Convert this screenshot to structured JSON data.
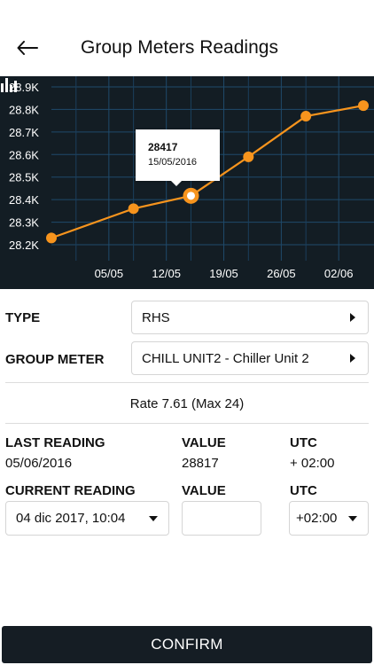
{
  "header": {
    "title": "Group Meters Readings",
    "back_icon": "arrow-left-icon"
  },
  "chart_data": {
    "type": "line",
    "x": [
      "28/04/2016",
      "08/05/2016",
      "15/05/2016",
      "22/05/2016",
      "29/05/2016",
      "05/06/2016"
    ],
    "series": [
      {
        "values": [
          28230,
          28360,
          28417,
          28590,
          28770,
          28817
        ],
        "color": "#f7941d"
      }
    ],
    "xticks": [
      "05/05",
      "12/05",
      "19/05",
      "26/05",
      "02/06"
    ],
    "yticks": [
      "28.9K",
      "28.8K",
      "28.7K",
      "28.6K",
      "28.5K",
      "28.4K",
      "28.3K",
      "28.2K"
    ],
    "ylim": [
      28200,
      28900
    ],
    "grid": true,
    "tooltip": {
      "value": "28417",
      "date": "15/05/2016"
    },
    "background": "#131d24"
  },
  "form": {
    "type_label": "TYPE",
    "type_value": "RHS",
    "group_meter_label": "GROUP METER",
    "group_meter_value": "CHILL UNIT2 - Chiller Unit 2",
    "rate_text": "Rate 7.61 (Max 24)",
    "last_reading_label": "LAST READING",
    "value_label": "VALUE",
    "utc_label": "UTC",
    "last_reading_date": "05/06/2016",
    "last_reading_value": "28817",
    "last_reading_utc": "+ 02:00",
    "current_reading_label": "CURRENT READING",
    "current_value_label": "VALUE",
    "current_utc_label": "UTC",
    "current_date": "04 dic 2017, 10:04",
    "current_value_placeholder": "",
    "current_utc": "+02:00"
  },
  "confirm_label": "CONFIRM"
}
